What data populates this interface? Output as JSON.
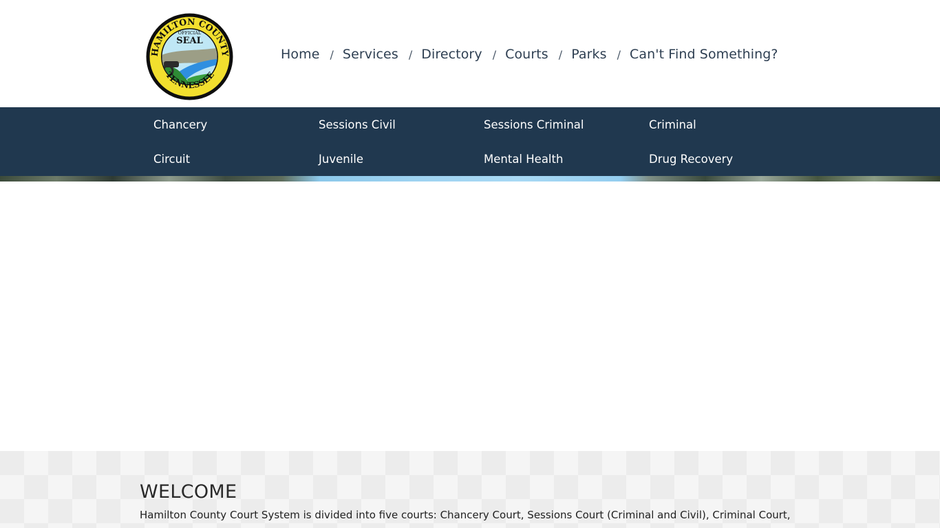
{
  "header": {
    "logo_alt": "Hamilton County Tennessee Official Seal",
    "logo_text": {
      "top": "HAMILTON COUNTY",
      "official": "OFFICIAL",
      "seal": "SEAL",
      "bottom": "TENNESSEE"
    },
    "nav": [
      {
        "label": "Home"
      },
      {
        "label": "Services"
      },
      {
        "label": "Directory"
      },
      {
        "label": "Courts"
      },
      {
        "label": "Parks"
      },
      {
        "label": "Can't Find Something?"
      }
    ],
    "separator": "/"
  },
  "courts_nav": {
    "items": [
      {
        "label": "Chancery"
      },
      {
        "label": "Sessions Civil"
      },
      {
        "label": "Sessions Criminal"
      },
      {
        "label": "Criminal"
      },
      {
        "label": "Circuit"
      },
      {
        "label": "Juvenile"
      },
      {
        "label": "Mental Health"
      },
      {
        "label": "Drug Recovery"
      }
    ]
  },
  "welcome": {
    "title": "WELCOME",
    "text": "Hamilton County Court System is divided into five courts: Chancery Court, Sessions Court (Criminal and Civil), Criminal Court,"
  },
  "colors": {
    "nav_text": "#2e3f52",
    "courts_bar": "#20384f",
    "courts_text": "#ffffff",
    "welcome_bg": "#ececec"
  }
}
